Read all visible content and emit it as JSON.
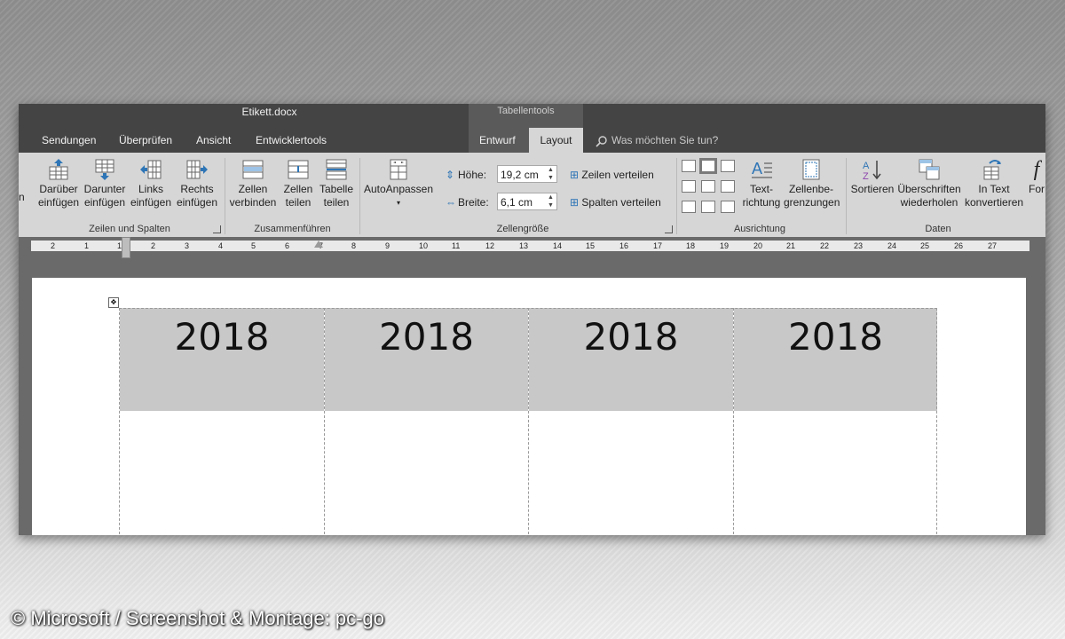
{
  "window": {
    "title": "Etikett.docx"
  },
  "context_group": {
    "label": "Tabellentools"
  },
  "tabs": [
    {
      "label": "Sendungen"
    },
    {
      "label": "Überprüfen"
    },
    {
      "label": "Ansicht"
    },
    {
      "label": "Entwicklertools"
    },
    {
      "label": "Entwurf"
    },
    {
      "label": "Layout"
    }
  ],
  "tell_me": {
    "placeholder": "Was möchten Sie tun?"
  },
  "ribbon": {
    "cut_off_left": "n",
    "groups": {
      "zeilen_spalten": {
        "label": "Zeilen und Spalten",
        "buttons": [
          {
            "line1": "Darüber",
            "line2": "einfügen"
          },
          {
            "line1": "Darunter",
            "line2": "einfügen"
          },
          {
            "line1": "Links",
            "line2": "einfügen"
          },
          {
            "line1": "Rechts",
            "line2": "einfügen"
          }
        ]
      },
      "zusammenfuehren": {
        "label": "Zusammenführen",
        "buttons": [
          {
            "line1": "Zellen",
            "line2": "verbinden"
          },
          {
            "line1": "Zellen",
            "line2": "teilen"
          },
          {
            "line1": "Tabelle",
            "line2": "teilen"
          }
        ]
      },
      "zellengroesse": {
        "label": "Zellengröße",
        "autofit": "AutoAnpassen",
        "height_label": "Höhe:",
        "height_value": "19,2 cm",
        "width_label": "Breite:",
        "width_value": "6,1 cm",
        "distribute_rows": "Zeilen verteilen",
        "distribute_cols": "Spalten verteilen"
      },
      "ausrichtung": {
        "label": "Ausrichtung",
        "text_direction": {
          "line1": "Text-",
          "line2": "richtung"
        },
        "cell_margins": {
          "line1": "Zellenbe-",
          "line2": "grenzungen"
        }
      },
      "daten": {
        "label": "Daten",
        "sort": "Sortieren",
        "repeat_header": {
          "line1": "Überschriften",
          "line2": "wiederholen"
        },
        "convert": {
          "line1": "In Text",
          "line2": "konvertieren"
        },
        "formula": "For"
      }
    }
  },
  "ruler": {
    "numbers": [
      "2",
      "1",
      "1",
      "2",
      "3",
      "4",
      "5",
      "6",
      "7",
      "8",
      "9",
      "10",
      "11",
      "12",
      "13",
      "14",
      "15",
      "16",
      "17",
      "18",
      "19",
      "20",
      "21",
      "22",
      "23",
      "24",
      "25",
      "26",
      "27"
    ]
  },
  "document": {
    "cells": [
      "2018",
      "2018",
      "2018",
      "2018"
    ]
  },
  "credit": "© Microsoft / Screenshot & Montage: pc-go",
  "colors": {
    "titlebar": "#444444",
    "ribbon": "#d6d6d6",
    "cell_fill": "#c8c8c8",
    "accent_blue": "#2e75b6"
  }
}
